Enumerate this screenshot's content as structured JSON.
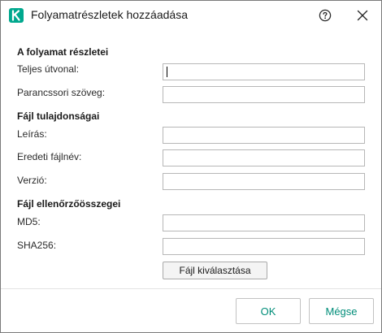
{
  "window": {
    "title": "Folyamatrészletek hozzáadása",
    "logo_letter": "K",
    "brand_color": "#00a88e",
    "accent_text_color": "#008d79"
  },
  "sections": {
    "process": {
      "heading": "A folyamat részletei"
    },
    "file_props": {
      "heading": "Fájl tulajdonságai"
    },
    "checksums": {
      "heading": "Fájl ellenőrzőösszegei"
    }
  },
  "fields": {
    "full_path": {
      "label": "Teljes útvonal:",
      "value": ""
    },
    "command_line": {
      "label": "Parancssori szöveg:",
      "value": ""
    },
    "description": {
      "label": "Leírás:",
      "value": ""
    },
    "original_filename": {
      "label": "Eredeti fájlnév:",
      "value": ""
    },
    "version": {
      "label": "Verzió:",
      "value": ""
    },
    "md5": {
      "label": "MD5:",
      "value": ""
    },
    "sha256": {
      "label": "SHA256:",
      "value": ""
    }
  },
  "buttons": {
    "select_file": "Fájl kiválasztása",
    "ok": "OK",
    "cancel": "Mégse"
  },
  "icons": {
    "help": "help-circle-icon",
    "close": "close-icon"
  }
}
